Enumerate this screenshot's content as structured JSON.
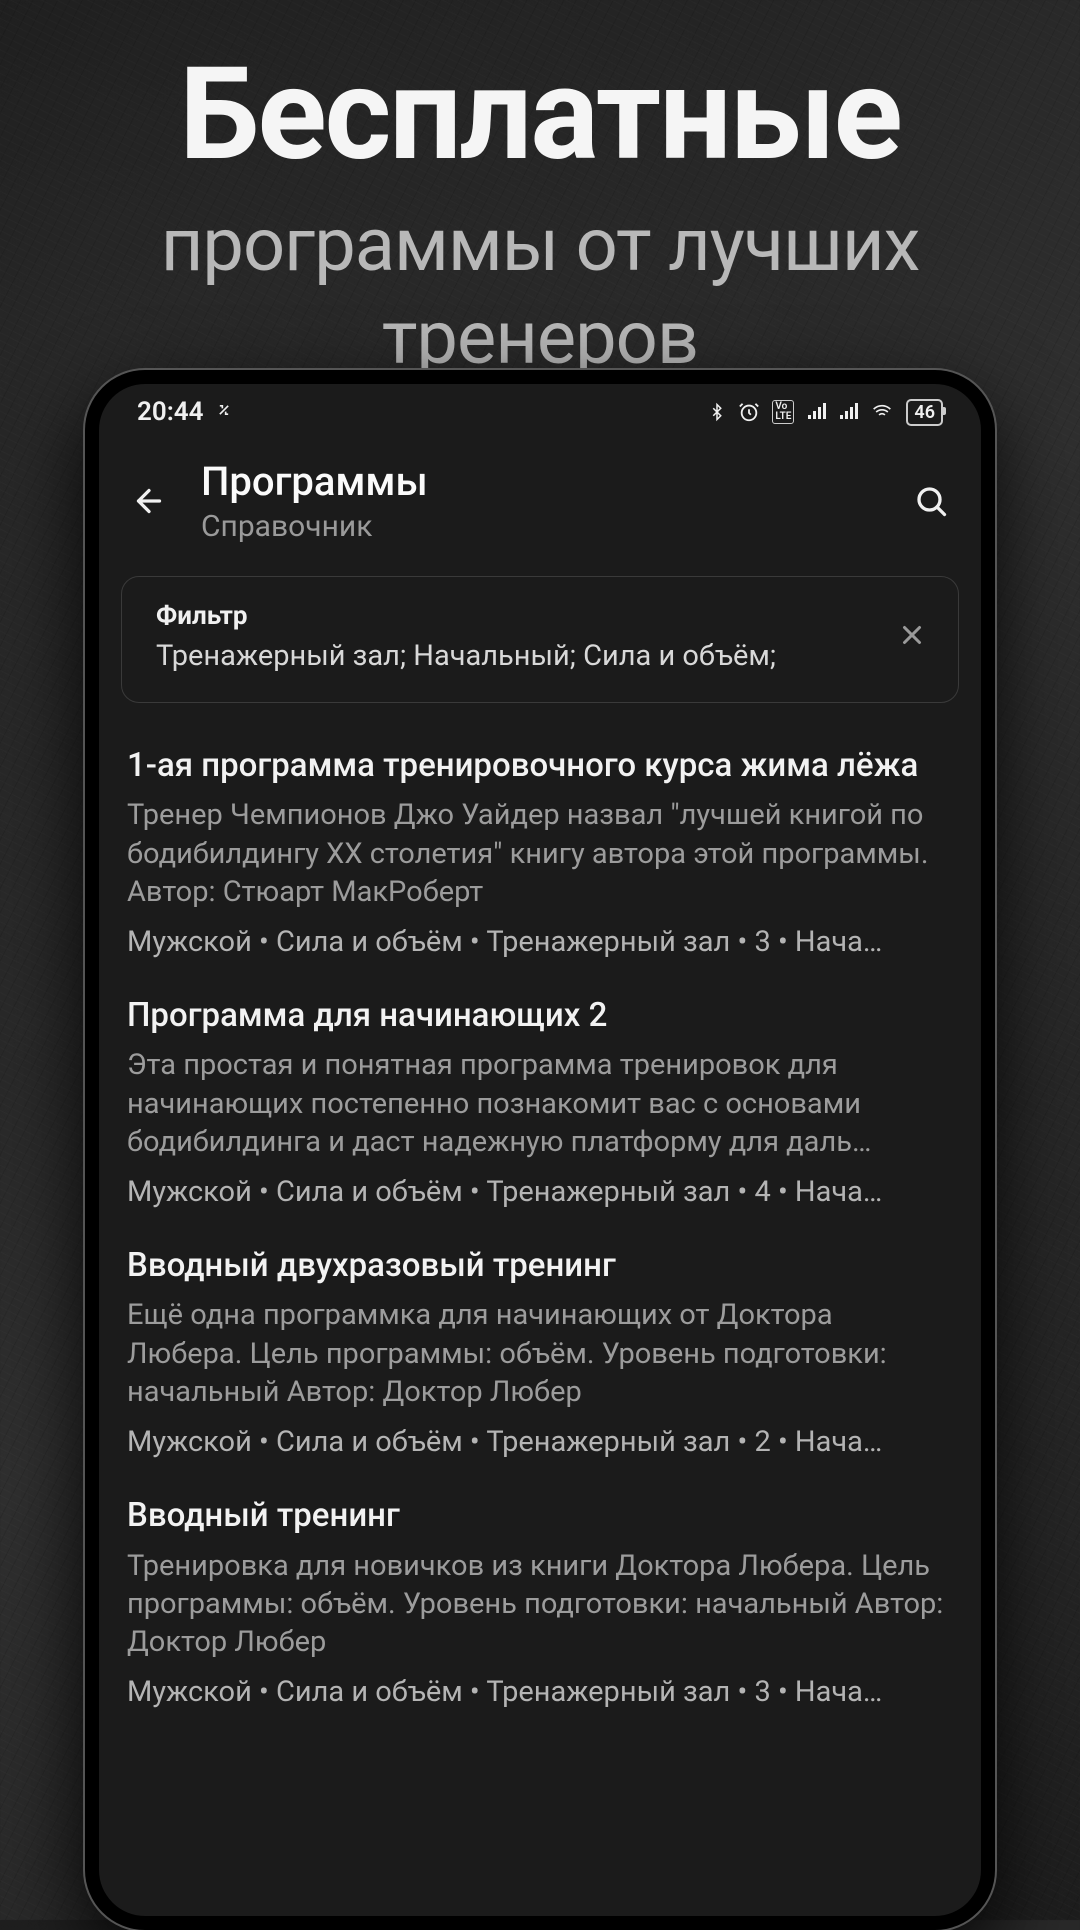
{
  "promo": {
    "headline": "Бесплатные",
    "subline": "программы от лучших тренеров"
  },
  "status": {
    "time": "20:44",
    "battery": "46"
  },
  "appbar": {
    "title": "Программы",
    "subtitle": "Справочник"
  },
  "filter": {
    "label": "Фильтр",
    "value": "Тренажерный зал; Начальный; Сила и объём;"
  },
  "items": [
    {
      "title": "1-ая программа тренировочного курса жима лёжа",
      "desc": "Тренер Чемпионов Джо Уайдер назвал \"лучшей книгой по бодибилдингу XX столетия\" книгу автора этой программы. Автор: Стюарт МакРоберт",
      "tags": "Мужской • Сила и объём • Тренажерный зал • 3 • Нача…"
    },
    {
      "title": "Программа для начинающих 2",
      "desc": "Эта простая и понятная программа тренировок для начинающих постепенно познакомит вас с основами бодибилдинга и даст надежную платформу для даль…",
      "tags": "Мужской • Сила и объём • Тренажерный зал • 4 • Нача…"
    },
    {
      "title": "Вводный двухразовый тренинг",
      "desc": "Ещё одна программка для начинающих от Доктора Любера. Цель программы: объём. Уровень подготовки: начальный Автор: Доктор Любер",
      "tags": "Мужской • Сила и объём • Тренажерный зал • 2 • Нача…"
    },
    {
      "title": "Вводный тренинг",
      "desc": "Тренировка для новичков из книги Доктора Любера. Цель программы: объём. Уровень подготовки: начальный Автор: Доктор Любер",
      "tags": "Мужской • Сила и объём • Тренажерный зал • 3 • Нача…"
    }
  ]
}
